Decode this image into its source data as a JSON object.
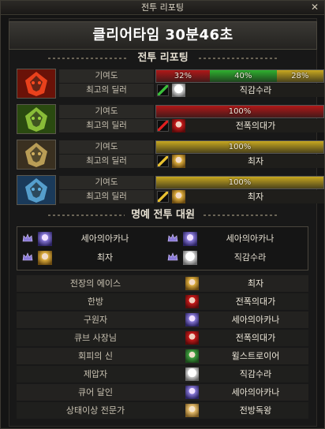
{
  "window": {
    "title": "전투 리포팅",
    "close_glyph": "✕"
  },
  "clear_time": "클리어타임  30분46초",
  "report_heading": "전투 리포팅",
  "row_labels": {
    "contribution": "기여도",
    "best_dealer": "최고의 딜러"
  },
  "players": [
    {
      "portrait_icon": "red-flame-mask-icon",
      "contribution_segments": [
        {
          "label": "32%",
          "value": 32,
          "color": "#b01818"
        },
        {
          "label": "40%",
          "value": 40,
          "color": "#2fb02f"
        },
        {
          "label": "28%",
          "value": 28,
          "color": "#c8a820"
        }
      ],
      "best_dealer": {
        "weapon_icon": "green-slash-icon",
        "avatar_icon": "white-haired-avatar-icon",
        "name": "직감수라"
      }
    },
    {
      "portrait_icon": "green-winged-mask-icon",
      "contribution_segments": [
        {
          "label": "100%",
          "value": 100,
          "color": "#b01818"
        }
      ],
      "best_dealer": {
        "weapon_icon": "red-slash-icon",
        "avatar_icon": "red-haired-avatar-icon",
        "name": "전폭의대가"
      }
    },
    {
      "portrait_icon": "gold-horned-mask-icon",
      "contribution_segments": [
        {
          "label": "100%",
          "value": 100,
          "color": "#c8a820"
        }
      ],
      "best_dealer": {
        "weapon_icon": "gold-slash-icon",
        "avatar_icon": "blonde-avatar-icon",
        "name": "최자"
      }
    },
    {
      "portrait_icon": "blue-winged-mask-icon",
      "contribution_segments": [
        {
          "label": "100%",
          "value": 100,
          "color": "#c8a820"
        }
      ],
      "best_dealer": {
        "weapon_icon": "gold-slash-icon",
        "avatar_icon": "blonde-avatar-icon",
        "name": "최자"
      }
    }
  ],
  "honor_heading": "명예 전투 대원",
  "honor_members": [
    {
      "name": "세아의아카나",
      "rank_icon": "rank-crown-icon",
      "avatar_icon": "violet-avatar-icon"
    },
    {
      "name": "세아의아카나",
      "rank_icon": "rank-crown-icon",
      "avatar_icon": "violet-avatar-icon"
    },
    {
      "name": "최자",
      "rank_icon": "rank-crown-icon",
      "avatar_icon": "blonde-avatar-icon"
    },
    {
      "name": "직감수라",
      "rank_icon": "rank-crown-icon",
      "avatar_icon": "white-haired-avatar-icon"
    }
  ],
  "titles": [
    {
      "title": "전장의 에이스",
      "player": "최자",
      "avatar_icon": "blonde-avatar-icon"
    },
    {
      "title": "한방",
      "player": "전폭의대가",
      "avatar_icon": "red-haired-avatar-icon"
    },
    {
      "title": "구원자",
      "player": "세아의아카나",
      "avatar_icon": "violet-avatar-icon"
    },
    {
      "title": "큐브 사장님",
      "player": "전폭의대가",
      "avatar_icon": "red-haired-avatar-icon"
    },
    {
      "title": "회피의 신",
      "player": "윌스트로이어",
      "avatar_icon": "green-avatar-icon"
    },
    {
      "title": "제압자",
      "player": "직감수라",
      "avatar_icon": "white-haired-avatar-icon"
    },
    {
      "title": "큐어 달인",
      "player": "세아의아카나",
      "avatar_icon": "violet-avatar-icon"
    },
    {
      "title": "상태이상 전문가",
      "player": "전방독왕",
      "avatar_icon": "gold-avatar-icon"
    }
  ]
}
